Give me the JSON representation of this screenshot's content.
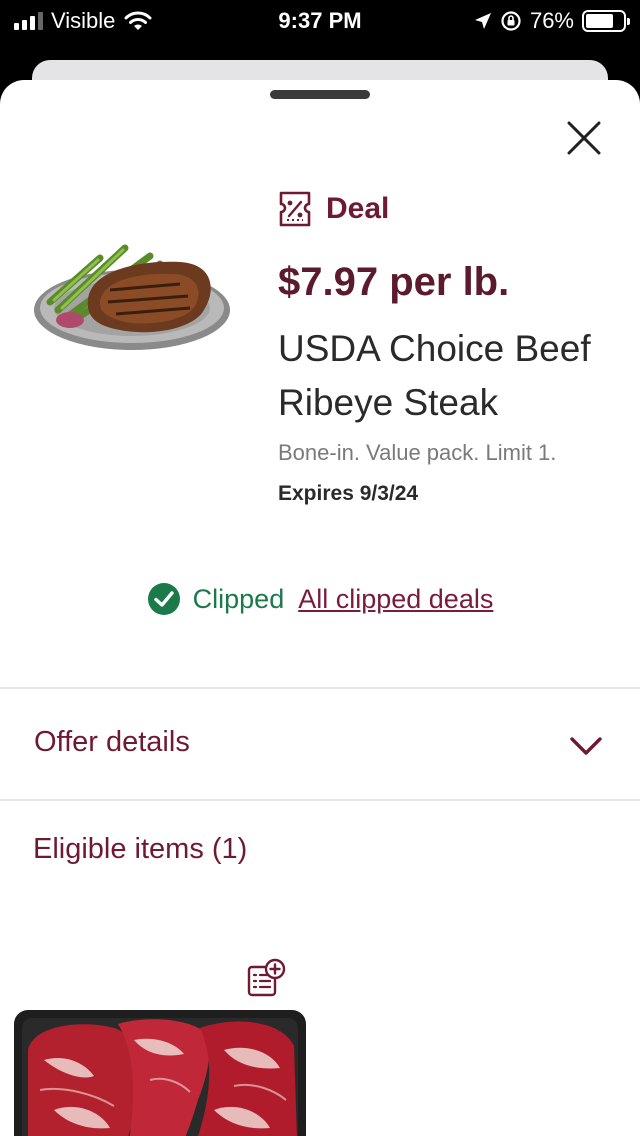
{
  "status_bar": {
    "carrier": "Visible",
    "time": "9:37 PM",
    "battery_percent": "76%",
    "battery_level": 0.76
  },
  "product": {
    "deal_label": "Deal",
    "price": "$7.97 per lb.",
    "title": "USDA Choice Beef Ribeye Steak",
    "description": "Bone-in. Value pack. Limit 1.",
    "expires": "Expires 9/3/24"
  },
  "clip_status": {
    "clipped_label": "Clipped",
    "all_clipped_link": "All clipped deals"
  },
  "sections": {
    "offer_details": "Offer details",
    "eligible_items": "Eligible items (1)"
  },
  "colors": {
    "brand": "#6e1a33",
    "success": "#1a7a4a"
  },
  "icons": {
    "close": "close-icon",
    "deal": "coupon-icon",
    "clipped": "check-circle-icon",
    "expand": "chevron-down-icon",
    "add_to_list": "add-to-list-icon"
  }
}
